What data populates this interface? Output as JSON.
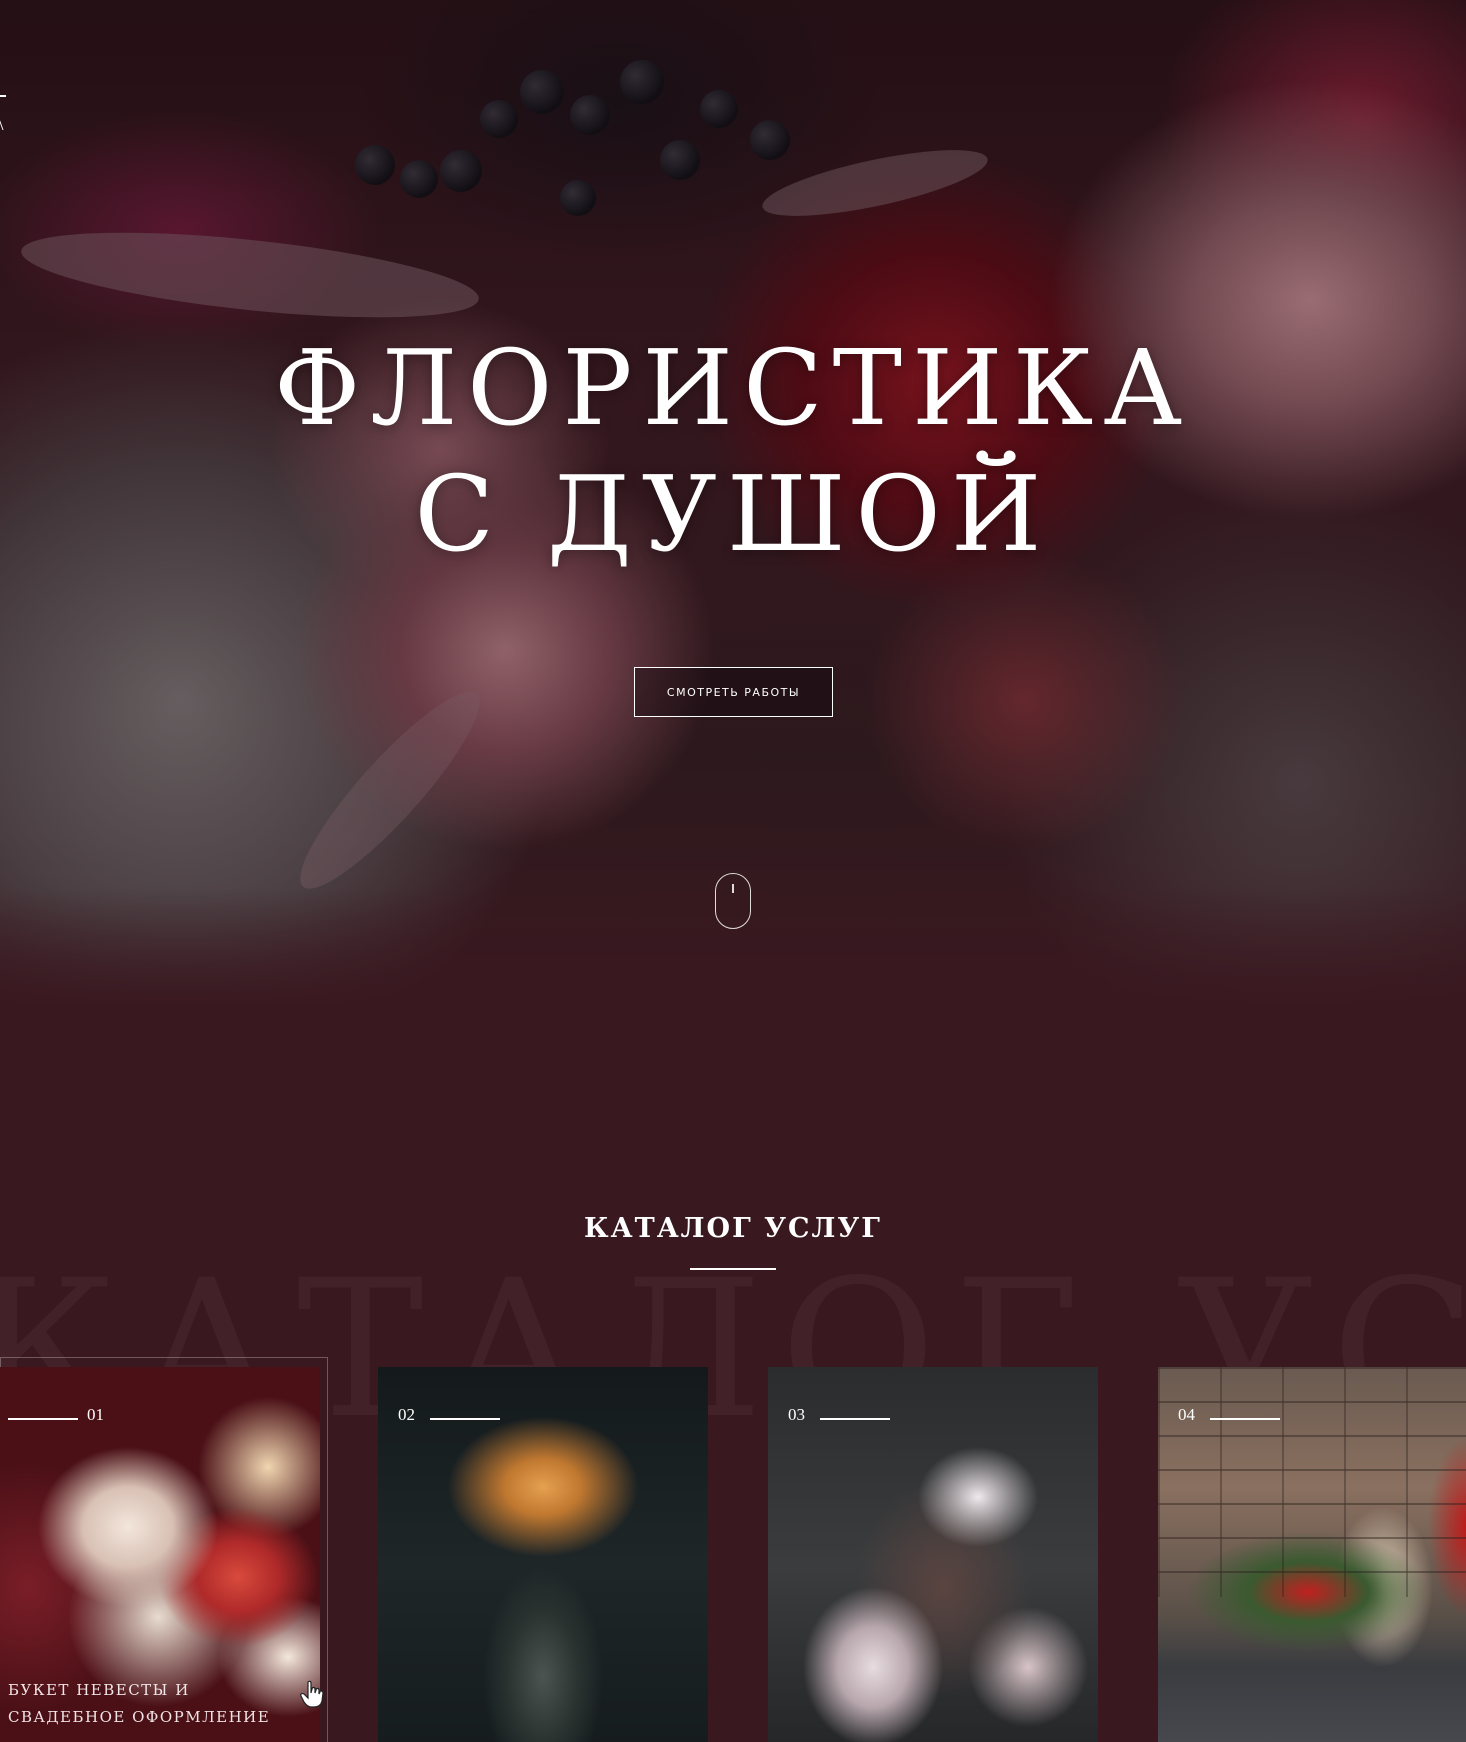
{
  "hero": {
    "title_line1": "ФЛОРИСТИКА",
    "title_line2": "С ДУШОЙ",
    "cta_label": "СМОТРЕТЬ РАБОТЫ",
    "scroll_icon": "mouse-scroll-icon"
  },
  "catalog": {
    "title": "КАТАЛОГ УСЛУГ",
    "watermark": "КАТАЛОГ УСЛУГ",
    "cards": [
      {
        "number": "01",
        "caption": "БУКЕТ НЕВЕСТЫ И СВАДЕБНОЕ ОФОРМЛЕНИЕ"
      },
      {
        "number": "02",
        "caption": ""
      },
      {
        "number": "03",
        "caption": ""
      },
      {
        "number": "04",
        "caption": ""
      }
    ]
  },
  "colors": {
    "background": "#3a1820",
    "text": "#ffffff"
  }
}
